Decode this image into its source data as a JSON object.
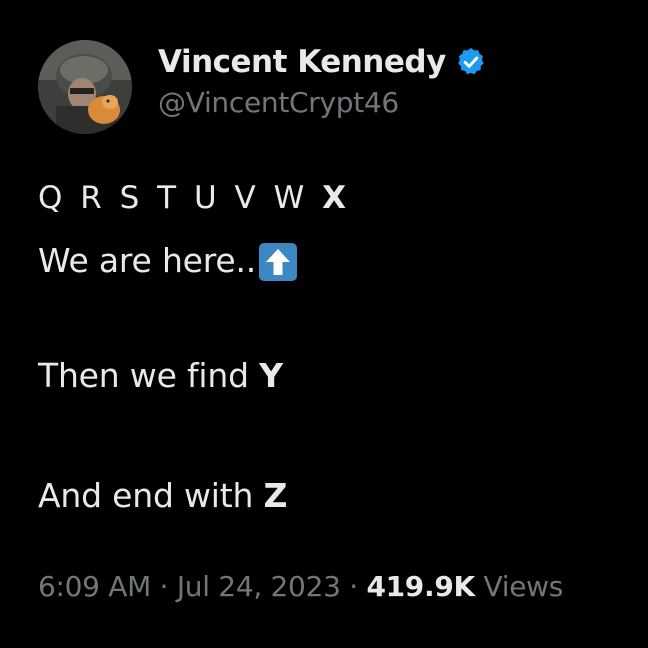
{
  "author": {
    "display_name": "Vincent Kennedy",
    "handle": "@VincentCrypt46",
    "verified_icon": "verified-badge-icon",
    "verified_color": "#1d9bf0"
  },
  "tweet": {
    "letters_regular": "Q R S T U V W",
    "letters_bold": "X",
    "line2_text": "We are here..",
    "line2_emoji": "up-arrow-emoji-icon",
    "line3_prefix": "Then we find",
    "line3_bold": "Y",
    "line4_prefix": "And end with",
    "line4_bold": "Z"
  },
  "meta": {
    "time": "6:09 AM",
    "separator": "·",
    "date": "Jul 24, 2023",
    "views_count": "419.9K",
    "views_label": "Views"
  },
  "colors": {
    "background": "#000000",
    "text": "#e7e9ea",
    "secondary": "#71767b",
    "accent": "#1d9bf0"
  }
}
